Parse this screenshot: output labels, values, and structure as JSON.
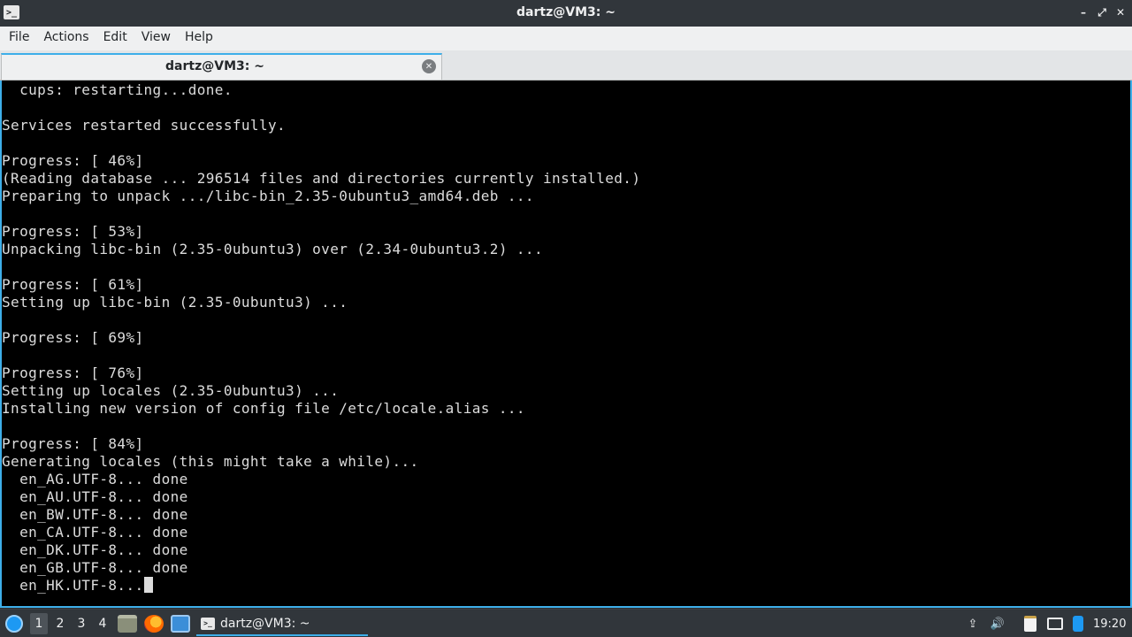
{
  "window": {
    "title": "dartz@VM3: ~",
    "app_icon": "terminal-icon",
    "controls": {
      "minimize": "–",
      "restore": "⤢",
      "close": "✕"
    }
  },
  "menubar": {
    "items": [
      "File",
      "Actions",
      "Edit",
      "View",
      "Help"
    ]
  },
  "tabs": [
    {
      "label": "dartz@VM3: ~",
      "close": "✕"
    }
  ],
  "terminal": {
    "lines": [
      "  cups: restarting...done.",
      "",
      "Services restarted successfully.",
      "",
      "Progress: [ 46%]",
      "(Reading database ... 296514 files and directories currently installed.)",
      "Preparing to unpack .../libc-bin_2.35-0ubuntu3_amd64.deb ...",
      "",
      "Progress: [ 53%]",
      "Unpacking libc-bin (2.35-0ubuntu3) over (2.34-0ubuntu3.2) ...",
      "",
      "Progress: [ 61%]",
      "Setting up libc-bin (2.35-0ubuntu3) ...",
      "",
      "Progress: [ 69%]",
      "",
      "Progress: [ 76%]",
      "Setting up locales (2.35-0ubuntu3) ...",
      "Installing new version of config file /etc/locale.alias ...",
      "",
      "Progress: [ 84%]",
      "Generating locales (this might take a while)...",
      "  en_AG.UTF-8... done",
      "  en_AU.UTF-8... done",
      "  en_BW.UTF-8... done",
      "  en_CA.UTF-8... done",
      "  en_DK.UTF-8... done",
      "  en_GB.UTF-8... done"
    ],
    "current_line": "  en_HK.UTF-8..."
  },
  "taskbar": {
    "start_icon": "app-menu-icon",
    "workspaces": [
      "1",
      "2",
      "3",
      "4"
    ],
    "active_workspace": "1",
    "launchers": [
      "file-manager-icon",
      "firefox-icon",
      "desktop-icon"
    ],
    "task": {
      "label": "dartz@VM3: ~",
      "icon": "terminal-icon"
    },
    "tray": [
      "upload-icon",
      "volume-icon",
      "clipboard-icon",
      "network-icon",
      "bluetooth-icon"
    ],
    "clock": "19:20"
  },
  "colors": {
    "accent": "#3daee9",
    "titlebar_bg": "#31363b",
    "terminal_bg": "#000000",
    "terminal_fg": "#dcdcdc"
  }
}
